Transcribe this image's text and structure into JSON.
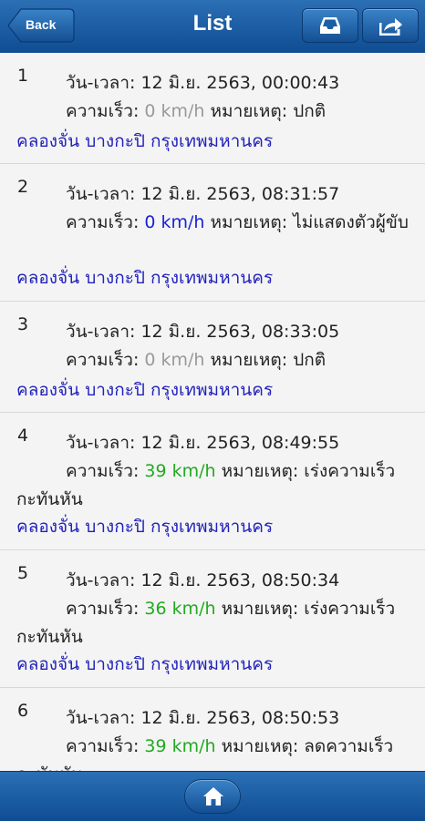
{
  "header": {
    "title": "List",
    "back_label": "Back",
    "actions": [
      {
        "icon": "inbox-icon"
      },
      {
        "icon": "share-icon"
      }
    ]
  },
  "labels": {
    "datetime": "วัน-เวลา:",
    "speed": "ความเร็ว:",
    "note": "หมายเหตุ:"
  },
  "colors": {
    "bar_blue": "#1a5ea6",
    "location_link": "#2222bb",
    "speed_zero": "#999999",
    "speed_blue": "#1a23d6",
    "speed_green": "#22aa22"
  },
  "items": [
    {
      "index": "1",
      "datetime": "12 มิ.ย. 2563, 00:00:43",
      "speed": "0 km/h",
      "speed_color": "gray",
      "note": "ปกติ",
      "location": "คลองจั่น บางกะปิ กรุงเทพมหานคร"
    },
    {
      "index": "2",
      "datetime": "12 มิ.ย. 2563, 08:31:57",
      "speed": "0 km/h",
      "speed_color": "blue",
      "note": "ไม่แสดงตัวผู้ขับ",
      "location": "คลองจั่น บางกะปิ กรุงเทพมหานคร"
    },
    {
      "index": "3",
      "datetime": "12 มิ.ย. 2563, 08:33:05",
      "speed": "0 km/h",
      "speed_color": "gray",
      "note": "ปกติ",
      "location": "คลองจั่น บางกะปิ กรุงเทพมหานคร"
    },
    {
      "index": "4",
      "datetime": "12 มิ.ย. 2563, 08:49:55",
      "speed": "39 km/h",
      "speed_color": "green",
      "note": "เร่งความเร็วกะทันหัน",
      "location": "คลองจั่น บางกะปิ กรุงเทพมหานคร"
    },
    {
      "index": "5",
      "datetime": "12 มิ.ย. 2563, 08:50:34",
      "speed": "36 km/h",
      "speed_color": "green",
      "note": "เร่งความเร็วกะทันหัน",
      "location": "คลองจั่น บางกะปิ กรุงเทพมหานคร"
    },
    {
      "index": "6",
      "datetime": "12 มิ.ย. 2563, 08:50:53",
      "speed": "39 km/h",
      "speed_color": "green",
      "note": "ลดความเร็วกะทันหัน",
      "location": ""
    }
  ],
  "footer": {
    "icon": "home-icon"
  }
}
